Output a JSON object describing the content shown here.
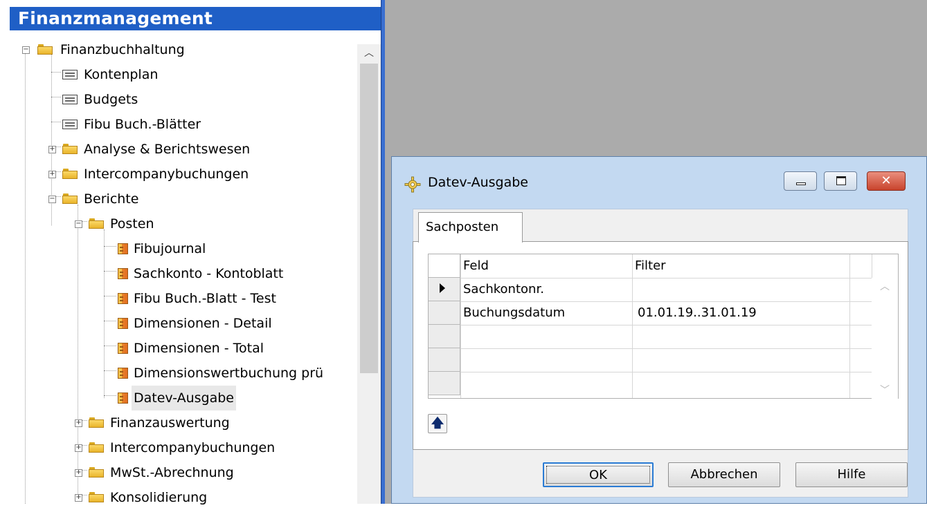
{
  "navigation": {
    "header": "Finanzmanagement",
    "tree": [
      {
        "label": "Finanzbuchhaltung"
      },
      {
        "label": "Kontenplan"
      },
      {
        "label": "Budgets"
      },
      {
        "label": "Fibu Buch.-Blätter"
      },
      {
        "label": "Analyse & Berichtswesen"
      },
      {
        "label": "Intercompanybuchungen"
      },
      {
        "label": "Berichte"
      },
      {
        "label": "Posten"
      },
      {
        "label": "Fibujournal"
      },
      {
        "label": "Sachkonto - Kontoblatt"
      },
      {
        "label": "Fibu Buch.-Blatt - Test"
      },
      {
        "label": "Dimensionen - Detail"
      },
      {
        "label": "Dimensionen - Total"
      },
      {
        "label": "Dimensionswertbuchung prü"
      },
      {
        "label": "Datev-Ausgabe"
      },
      {
        "label": "Finanzauswertung"
      },
      {
        "label": "Intercompanybuchungen"
      },
      {
        "label": "MwSt.-Abrechnung"
      },
      {
        "label": "Konsolidierung"
      }
    ]
  },
  "dialog": {
    "title": "Datev-Ausgabe",
    "tab": "Sachposten",
    "grid": {
      "headers": [
        "Feld",
        "Filter"
      ],
      "rows": [
        {
          "field": "Sachkontonr.",
          "filter": ""
        },
        {
          "field": "Buchungsdatum",
          "filter": "01.01.19..31.01.19"
        },
        {
          "field": "",
          "filter": ""
        },
        {
          "field": "",
          "filter": ""
        },
        {
          "field": "",
          "filter": ""
        }
      ]
    },
    "buttons": {
      "ok": "OK",
      "cancel": "Abbrechen",
      "help": "Hilfe"
    }
  }
}
